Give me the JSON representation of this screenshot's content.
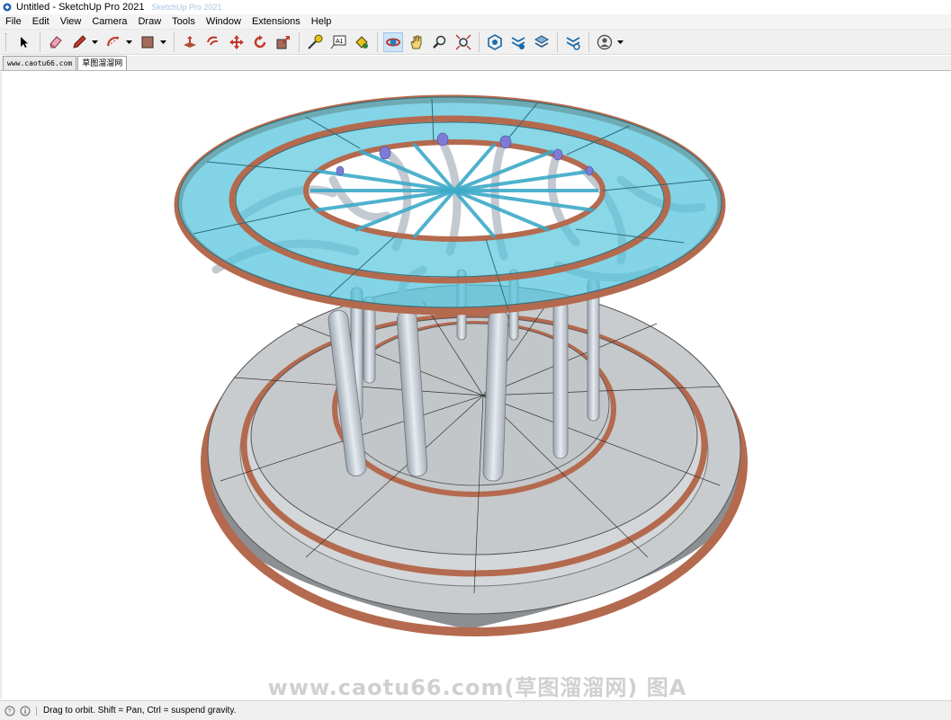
{
  "window": {
    "title": "Untitled - SketchUp Pro 2021",
    "ghost_title": "SketchUp Pro 2021"
  },
  "menu": [
    "File",
    "Edit",
    "View",
    "Camera",
    "Draw",
    "Tools",
    "Window",
    "Extensions",
    "Help"
  ],
  "toolbar": {
    "tools": [
      {
        "name": "select-icon"
      },
      {
        "name": "eraser-icon"
      },
      {
        "name": "pencil-line-icon"
      },
      {
        "name": "arc-icon"
      },
      {
        "name": "rectangle-icon"
      },
      {
        "name": "push-pull-icon"
      },
      {
        "name": "offset-icon"
      },
      {
        "name": "move-icon"
      },
      {
        "name": "rotate-icon"
      },
      {
        "name": "scale-icon"
      },
      {
        "name": "tape-measure-icon"
      },
      {
        "name": "text-icon"
      },
      {
        "name": "paint-bucket-icon"
      },
      {
        "name": "orbit-icon"
      },
      {
        "name": "pan-icon"
      },
      {
        "name": "zoom-icon"
      },
      {
        "name": "zoom-extents-icon"
      },
      {
        "name": "warehouse-icon"
      },
      {
        "name": "extension-warehouse-icon"
      },
      {
        "name": "layout-icon"
      },
      {
        "name": "extension-manager-icon"
      },
      {
        "name": "account-icon"
      }
    ],
    "text_tool_glyph": "A1",
    "active_tool": "orbit-icon"
  },
  "scene_tabs": [
    "www.caotu66.com",
    "草图溜溜网"
  ],
  "watermark": "www.caotu66.com(草图溜溜网) 图A",
  "status": {
    "message": "Drag to orbit. Shift = Pan, Ctrl = suspend gravity."
  },
  "colors": {
    "glass": "#5cc7dd",
    "wood_trim": "#b46a4e",
    "concrete": "#c9ccce",
    "columns": "#c6ccd3",
    "active_tool_bg": "#cce4f7"
  }
}
